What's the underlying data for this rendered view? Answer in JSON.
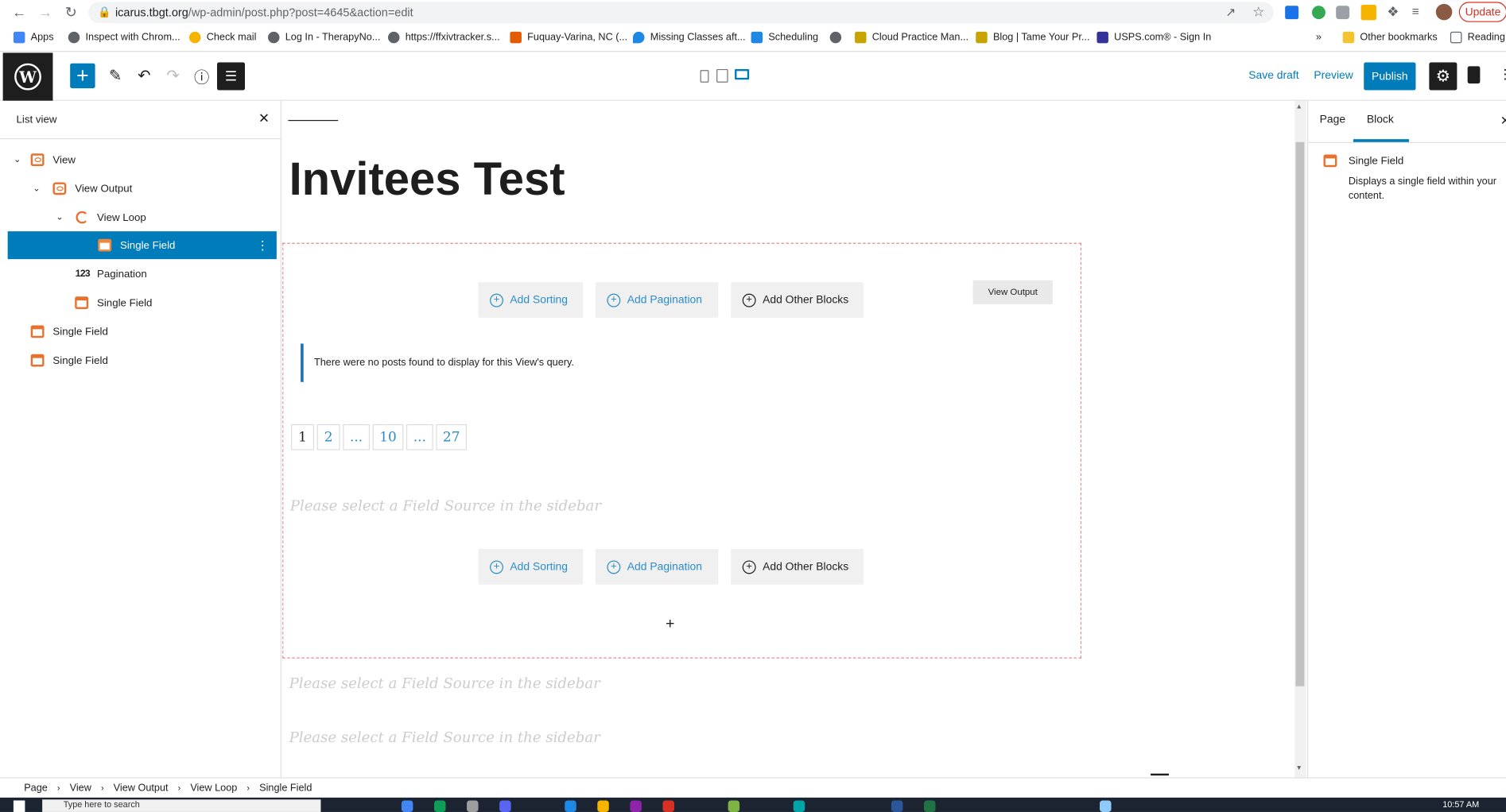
{
  "browser": {
    "url_host": "icarus.tbgt.org",
    "url_path": "/wp-admin/post.php?post=4645&action=edit",
    "update_label": "Update",
    "bookmarks": [
      {
        "label": "Apps",
        "color": "#4285f4"
      },
      {
        "label": "Inspect with Chrom...",
        "color": "#5f6368"
      },
      {
        "label": "Check mail",
        "color": "#f4b400"
      },
      {
        "label": "Log In - TherapyNo...",
        "color": "#5f6368"
      },
      {
        "label": "https://ffxivtracker.s...",
        "color": "#5f6368"
      },
      {
        "label": "Fuquay-Varina, NC (...",
        "color": "#e35b00"
      },
      {
        "label": "Missing Classes aft...",
        "color": "#1e88e5"
      },
      {
        "label": "Scheduling",
        "color": "#1e88e5"
      },
      {
        "label": "Cloud Practice Man...",
        "color": "#c8a400"
      },
      {
        "label": "Blog | Tame Your Pr...",
        "color": "#c8a400"
      },
      {
        "label": "USPS.com® - Sign In",
        "color": "#333399"
      }
    ],
    "other_bookmarks": "Other bookmarks",
    "reading_list": "Reading"
  },
  "toolbar": {
    "save_draft": "Save draft",
    "preview": "Preview",
    "publish": "Publish"
  },
  "list_view": {
    "title": "List view",
    "items": [
      {
        "label": "View",
        "icon": "view-icon"
      },
      {
        "label": "View Output",
        "icon": "eye-icon"
      },
      {
        "label": "View Loop",
        "icon": "loop-icon"
      },
      {
        "label": "Single Field",
        "icon": "calendar-icon"
      },
      {
        "label": "Pagination",
        "icon": "123"
      },
      {
        "label": "Single Field",
        "icon": "calendar-icon"
      },
      {
        "label": "Single Field",
        "icon": "calendar-icon"
      },
      {
        "label": "Single Field",
        "icon": "calendar-icon"
      }
    ]
  },
  "canvas": {
    "title": "Invitees Test",
    "add_sorting": "Add Sorting",
    "add_pagination": "Add Pagination",
    "add_other_blocks": "Add Other Blocks",
    "view_output_tag": "View Output",
    "notice": "There were no posts found to display for this View's query.",
    "pagination": [
      "1",
      "2",
      "...",
      "10",
      "...",
      "27"
    ],
    "field_placeholder": "Please select a Field Source in the sidebar",
    "add_block_plus": "+"
  },
  "sidebar": {
    "tab_page": "Page",
    "tab_block": "Block",
    "block_name": "Single Field",
    "block_desc": "Displays a single field within your content."
  },
  "breadcrumb": [
    "Page",
    "View",
    "View Output",
    "View Loop",
    "Single Field"
  ],
  "taskbar": {
    "search_placeholder": "Type here to search",
    "time": "10:57 AM"
  }
}
